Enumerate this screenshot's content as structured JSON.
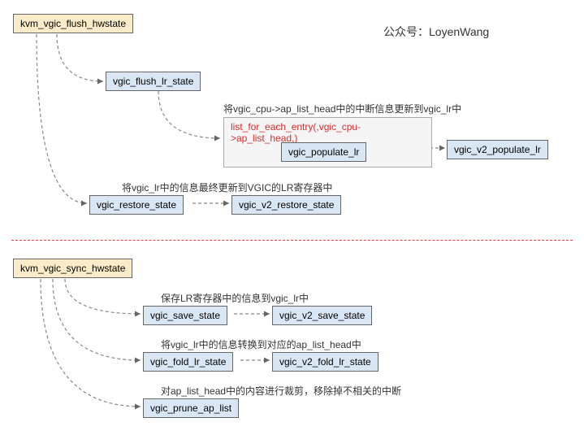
{
  "watermark": "公众号：LoyenWang",
  "flush": {
    "root": "kvm_vgic_flush_hwstate",
    "flush_lr": "vgic_flush_lr_state",
    "desc1": "将vgic_cpu->ap_list_head中的中断信息更新到vgic_lr中",
    "loop_code": "list_for_each_entry(,vgic_cpu->ap_list_head,)",
    "populate": "vgic_populate_lr",
    "v2_populate": "vgic_v2_populate_lr",
    "desc2": "将vgic_lr中的信息最终更新到VGIC的LR寄存器中",
    "restore": "vgic_restore_state",
    "v2_restore": "vgic_v2_restore_state"
  },
  "sync": {
    "root": "kvm_vgic_sync_hwstate",
    "desc1": "保存LR寄存器中的信息到vgic_lr中",
    "save": "vgic_save_state",
    "v2_save": "vgic_v2_save_state",
    "desc2": "将vgic_lr中的信息转换到对应的ap_list_head中",
    "fold": "vgic_fold_lr_state",
    "v2_fold": "vgic_v2_fold_lr_state",
    "desc3": "对ap_list_head中的内容进行裁剪，移除掉不相关的中断",
    "prune": "vgic_prune_ap_list"
  }
}
